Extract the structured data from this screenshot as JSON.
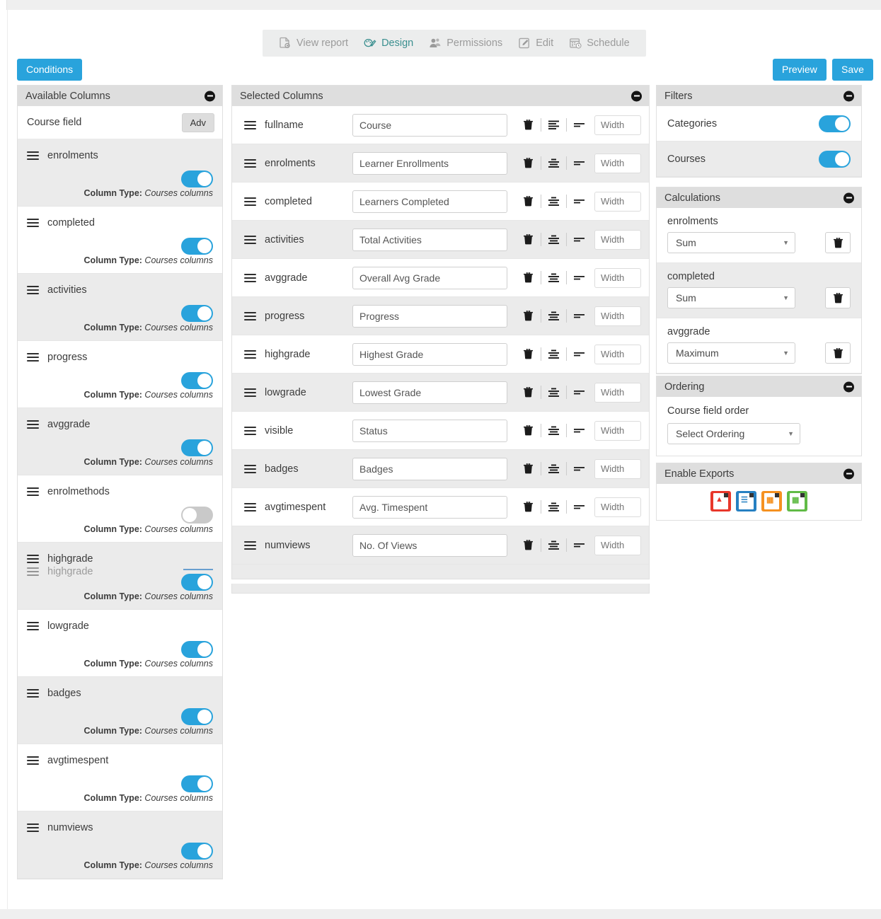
{
  "nav": {
    "tabs": [
      {
        "label": "View report",
        "icon": "report-page-icon",
        "active": false
      },
      {
        "label": "Design",
        "icon": "palette-brush-icon",
        "active": true
      },
      {
        "label": "Permissions",
        "icon": "users-permissions-icon",
        "active": false
      },
      {
        "label": "Edit",
        "icon": "pencil-square-icon",
        "active": false
      },
      {
        "label": "Schedule",
        "icon": "calendar-clock-icon",
        "active": false
      }
    ]
  },
  "toolbar": {
    "conditions_label": "Conditions",
    "preview_label": "Preview",
    "save_label": "Save",
    "accent_color": "#29a3dc"
  },
  "available_columns": {
    "title": "Available Columns",
    "course_field_label": "Course field",
    "adv_label": "Adv",
    "column_type_prefix": "Column Type:",
    "column_type_value": "Courses columns",
    "items": [
      {
        "name": "enrolments",
        "enabled": true,
        "type": "Courses columns"
      },
      {
        "name": "completed",
        "enabled": true,
        "type": "Courses columns"
      },
      {
        "name": "activities",
        "enabled": true,
        "type": "Courses columns"
      },
      {
        "name": "progress",
        "enabled": true,
        "type": "Courses columns"
      },
      {
        "name": "avggrade",
        "enabled": true,
        "type": "Courses columns"
      },
      {
        "name": "enrolmethods",
        "enabled": false,
        "type": "Courses columns"
      },
      {
        "name": "highgrade",
        "enabled": true,
        "type": "Courses columns",
        "dragging": true,
        "ghost_name": "highgrade"
      },
      {
        "name": "lowgrade",
        "enabled": true,
        "type": "Courses columns"
      },
      {
        "name": "badges",
        "enabled": true,
        "type": "Courses columns"
      },
      {
        "name": "avgtimespent",
        "enabled": true,
        "type": "Courses columns"
      },
      {
        "name": "numviews",
        "enabled": true,
        "type": "Courses columns"
      }
    ]
  },
  "selected_columns": {
    "title": "Selected Columns",
    "width_placeholder": "Width",
    "rows": [
      {
        "name": "fullname",
        "label": "Course",
        "align": "align-left-icon",
        "width": ""
      },
      {
        "name": "enrolments",
        "label": "Learner Enrollments",
        "align": "align-center-icon",
        "width": ""
      },
      {
        "name": "completed",
        "label": "Learners Completed",
        "align": "align-center-icon",
        "width": ""
      },
      {
        "name": "activities",
        "label": "Total Activities",
        "align": "align-center-icon",
        "width": ""
      },
      {
        "name": "avggrade",
        "label": "Overall Avg Grade",
        "align": "align-center-icon",
        "width": ""
      },
      {
        "name": "progress",
        "label": "Progress",
        "align": "align-center-icon",
        "width": ""
      },
      {
        "name": "highgrade",
        "label": "Highest Grade",
        "align": "align-center-icon",
        "width": ""
      },
      {
        "name": "lowgrade",
        "label": "Lowest Grade",
        "align": "align-center-icon",
        "width": ""
      },
      {
        "name": "visible",
        "label": "Status",
        "align": "align-center-icon",
        "width": ""
      },
      {
        "name": "badges",
        "label": "Badges",
        "align": "align-center-icon",
        "width": ""
      },
      {
        "name": "avgtimespent",
        "label": "Avg. Timespent",
        "align": "align-center-icon",
        "width": ""
      },
      {
        "name": "numviews",
        "label": "No. Of Views",
        "align": "align-center-icon",
        "width": ""
      }
    ]
  },
  "filters": {
    "title": "Filters",
    "rows": [
      {
        "label": "Categories",
        "enabled": true
      },
      {
        "label": "Courses",
        "enabled": true
      }
    ]
  },
  "calculations": {
    "title": "Calculations",
    "rows": [
      {
        "label": "enrolments",
        "value": "Sum"
      },
      {
        "label": "completed",
        "value": "Sum"
      },
      {
        "label": "avggrade",
        "value": "Maximum"
      }
    ]
  },
  "ordering": {
    "title": "Ordering",
    "field_label": "Course field order",
    "value": "Select Ordering"
  },
  "exports": {
    "title": "Enable Exports",
    "items": [
      {
        "label": "PDF",
        "color": "#e8372b"
      },
      {
        "label": "CSV",
        "color": "#2680c2"
      },
      {
        "label": "XLS",
        "color": "#f59120"
      },
      {
        "label": "ODS",
        "color": "#61bb46"
      }
    ]
  }
}
